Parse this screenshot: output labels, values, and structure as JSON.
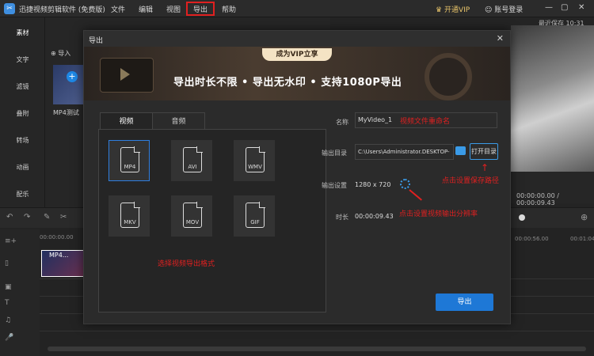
{
  "titlebar": {
    "app_title": "迅捷视频剪辑软件 (免费版)",
    "menu": [
      "文件",
      "编辑",
      "视图",
      "导出",
      "帮助"
    ],
    "vip_label": "开通VIP",
    "login_label": "账号登录",
    "last_save": "最近保存 10:31"
  },
  "sidebar": {
    "items": [
      "素材",
      "文字",
      "滤镜",
      "叠附",
      "转场",
      "动画",
      "配乐"
    ]
  },
  "media": {
    "import_label": "导入",
    "thumb_label": "MP4测试"
  },
  "preview": {
    "time": "00:00:00.00 / 00:00:09.43"
  },
  "timeline": {
    "ruler_start": "00:00:00.00",
    "ruler_mid": "00:00:56.00",
    "ruler_end": "00:01:04",
    "clip_label": "MP4..."
  },
  "dialog": {
    "title": "导出",
    "banner_tag": "成为VIP立享",
    "banner_text": "导出时长不限 • 导出无水印 • 支持1080P导出",
    "tabs": [
      "视频",
      "音频"
    ],
    "formats": [
      "MP4",
      "AVI",
      "WMV",
      "MKV",
      "MOV",
      "GIF"
    ],
    "format_hint": "选择视频导出格式",
    "name_label": "名称",
    "name_value": "MyVideo_1",
    "name_note": "视频文件重命名",
    "dir_label": "输出目录",
    "dir_value": "C:\\Users\\Administrator.DESKTOP-",
    "open_dir_label": "打开目录",
    "save_note": "点击设置保存路径",
    "settings_label": "输出设置",
    "resolution": "1280 x 720",
    "res_note": "点击设置视频输出分辨率",
    "duration_label": "时长",
    "duration_value": "00:00:09.43",
    "export_label": "导出",
    "close_glyph": "✕"
  }
}
